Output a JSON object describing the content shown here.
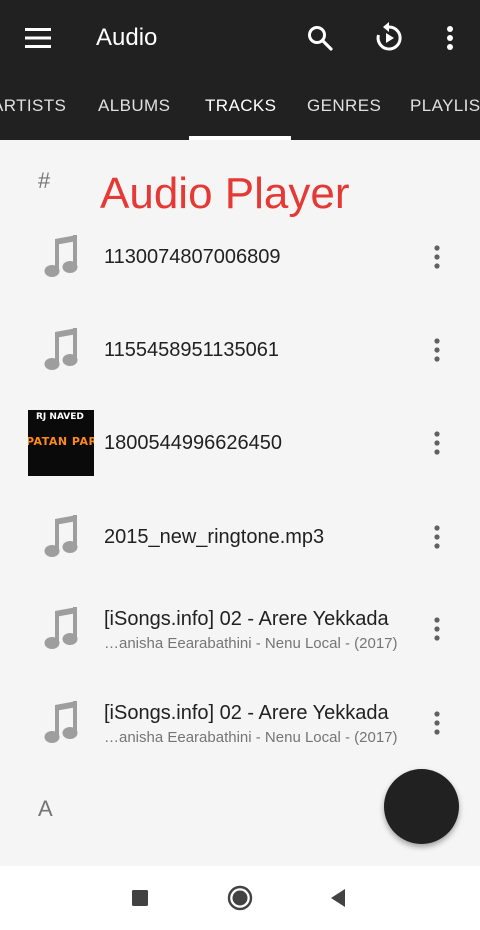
{
  "toolbar": {
    "title": "Audio",
    "menu_icon": "menu-icon",
    "search_icon": "search-icon",
    "refresh_icon": "replay-icon",
    "overflow_icon": "more-vert-icon"
  },
  "tabs": [
    {
      "label": "ARTISTS",
      "active": false
    },
    {
      "label": "ALBUMS",
      "active": false
    },
    {
      "label": "TRACKS",
      "active": true
    },
    {
      "label": "GENRES",
      "active": false
    },
    {
      "label": "PLAYLISTS",
      "active": false
    }
  ],
  "overlay": {
    "title": "Audio Player",
    "color": "#e53935"
  },
  "sections": [
    {
      "header": "#"
    },
    {
      "header": "A"
    }
  ],
  "tracks": [
    {
      "title": "1130074807006809",
      "subtitle": "",
      "thumb": "music-note-icon"
    },
    {
      "title": "1155458951135061",
      "subtitle": "",
      "thumb": "music-note-icon"
    },
    {
      "title": "1800544996626450",
      "subtitle": "",
      "thumb": "album-cover",
      "cover_text_1": "RJ NAVED",
      "cover_text_2": "PATAN PARAS"
    },
    {
      "title": "2015_new_ringtone.mp3",
      "subtitle": "",
      "thumb": "music-note-icon"
    },
    {
      "title": "[iSongs.info] 02 - Arere Yekkada",
      "subtitle": "…anisha Eearabathini - Nenu Local - (2017)",
      "thumb": "music-note-icon"
    },
    {
      "title": "[iSongs.info] 02 - Arere Yekkada",
      "subtitle": "…anisha Eearabathini - Nenu Local - (2017)",
      "thumb": "music-note-icon"
    }
  ],
  "fab": {
    "icon": "play-icon"
  },
  "navbar": {
    "recents_icon": "recents-icon",
    "home_icon": "home-icon",
    "back_icon": "back-icon"
  },
  "colors": {
    "toolbar": "#212121",
    "accent_text": "#e53935",
    "icon_grey": "#9e9e9e"
  }
}
